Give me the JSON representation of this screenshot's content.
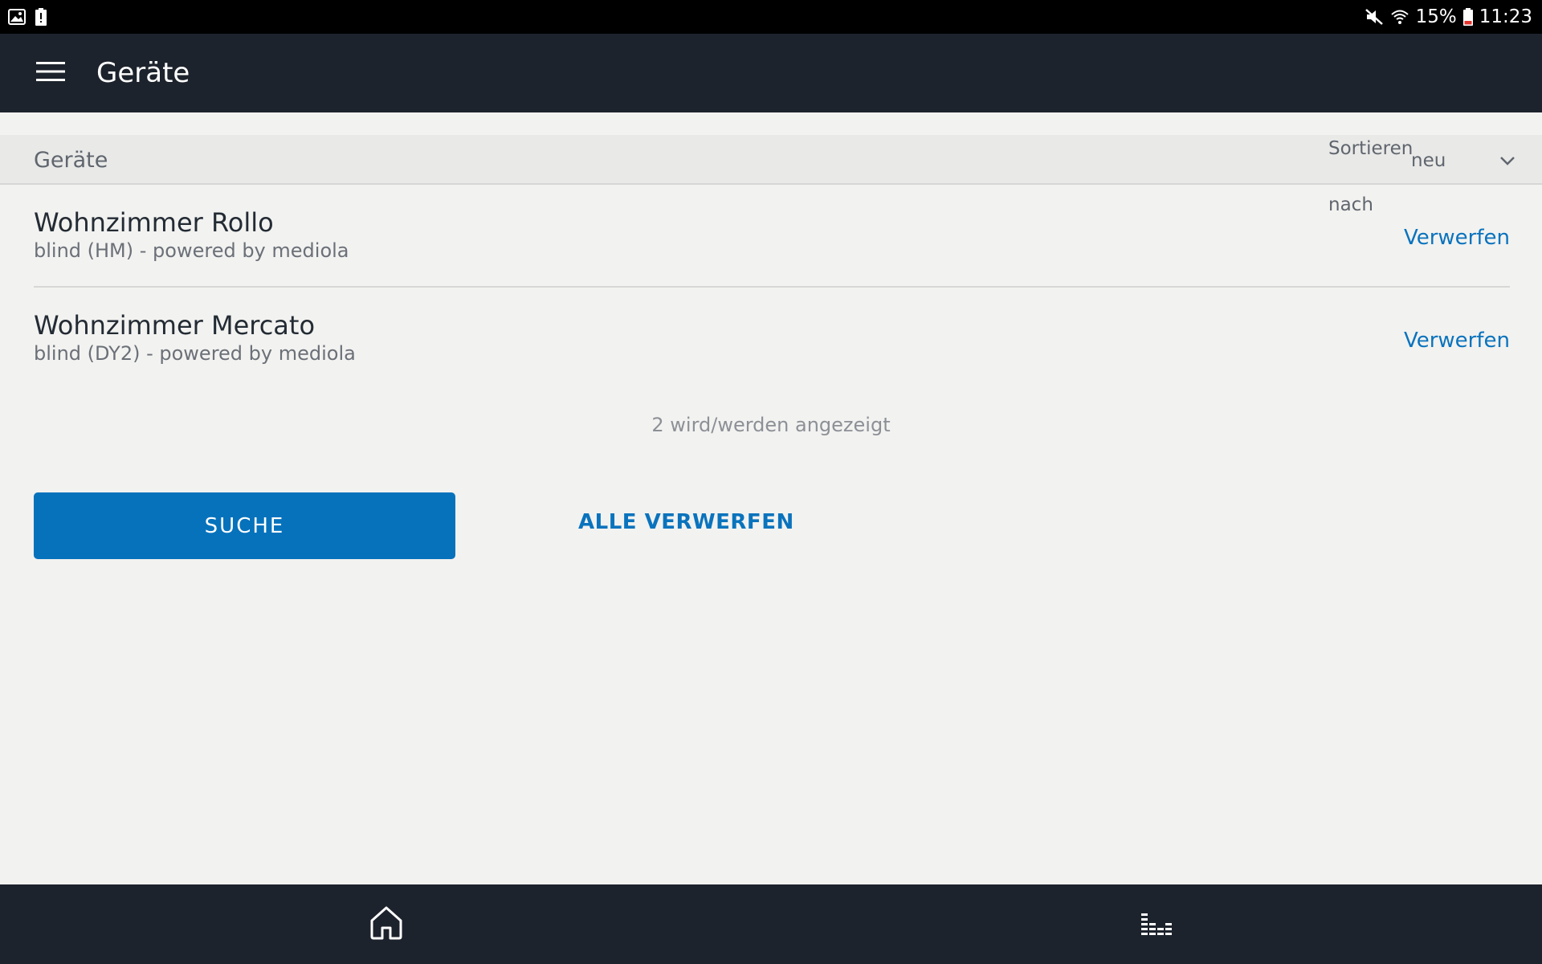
{
  "status_bar": {
    "battery_percent": "15%",
    "time": "11:23",
    "icons": [
      "image-icon",
      "battery-alert-icon",
      "mute-icon",
      "wifi-icon",
      "battery-icon"
    ]
  },
  "app_bar": {
    "title": "Geräte",
    "menu_icon": "hamburger-icon"
  },
  "section": {
    "title": "Geräte",
    "sort_label": "Sortieren nach",
    "sort_value": "neu"
  },
  "devices": [
    {
      "name": "Wohnzimmer Rollo",
      "subtitle": "blind (HM) - powered by mediola",
      "action": "Verwerfen"
    },
    {
      "name": "Wohnzimmer Mercato",
      "subtitle": "blind (DY2) - powered by mediola",
      "action": "Verwerfen"
    }
  ],
  "count_text": "2 wird/werden angezeigt",
  "buttons": {
    "search": "SUCHE",
    "discard_all": "ALLE VERWERFEN"
  },
  "colors": {
    "accent": "#0672bc",
    "appbar": "#1d232c",
    "background": "#f2f2f0"
  }
}
